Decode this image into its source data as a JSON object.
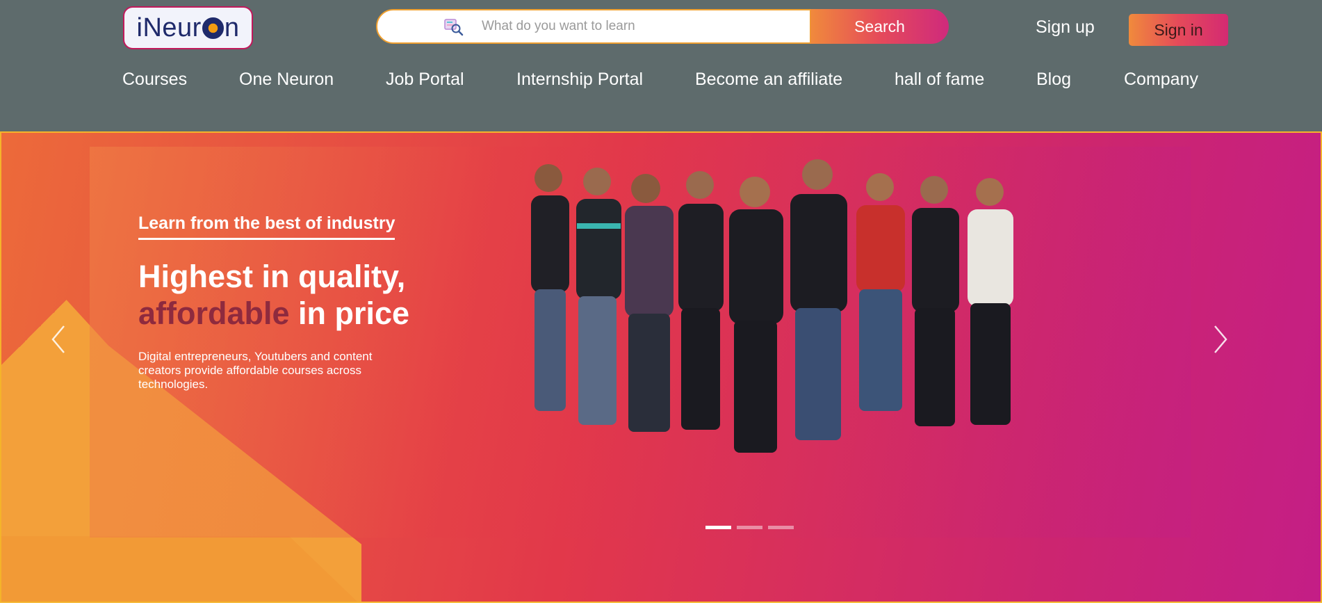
{
  "colors": {
    "header_bg": "#5e6b6c",
    "accent_gradient_start": "#f08a3c",
    "accent_gradient_end": "#cf2a7c",
    "hero_accent_text": "#8e2a3e",
    "logo_border": "#c2185b"
  },
  "header": {
    "logo_text_before": "iNeur",
    "logo_text_after": "n",
    "search": {
      "placeholder": "What do you want to learn",
      "value": "",
      "icon": "search-icon",
      "button_label": "Search"
    },
    "signup_label": "Sign up",
    "signin_label": "Sign in"
  },
  "nav": {
    "items": [
      {
        "label": "Courses"
      },
      {
        "label": "One Neuron"
      },
      {
        "label": "Job Portal"
      },
      {
        "label": "Internship Portal"
      },
      {
        "label": "Become an affiliate"
      },
      {
        "label": "hall of fame"
      },
      {
        "label": "Blog"
      },
      {
        "label": "Company"
      }
    ]
  },
  "hero": {
    "kicker": "Learn from the best of industry",
    "headline_line1": "Highest in quality,",
    "headline_accent": "affordable",
    "headline_rest": " in price",
    "description": "Digital entrepreneurs, Youtubers and content creators provide affordable courses across technologies.",
    "prev_icon": "chevron-left-icon",
    "next_icon": "chevron-right-icon",
    "slides_total": 3,
    "slide_active": 1
  }
}
